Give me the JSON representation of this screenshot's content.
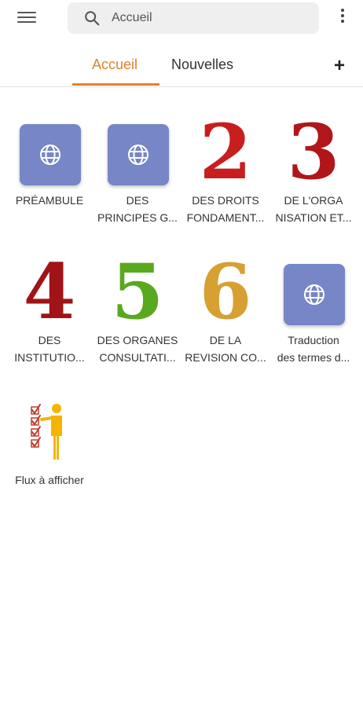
{
  "search": {
    "text": "Accueil",
    "icon": "search-icon"
  },
  "tabs": [
    {
      "label": "Accueil",
      "active": true
    },
    {
      "label": "Nouvelles",
      "active": false
    }
  ],
  "accent_color": "#e1822a",
  "tiles": [
    {
      "icon": "globe-icon",
      "label_lines": [
        "PRÉAMBULE"
      ]
    },
    {
      "icon": "globe-icon",
      "label_lines": [
        "DES",
        "PRINCIPES G..."
      ]
    },
    {
      "numeral": "2",
      "color": "#c81e1e",
      "label_lines": [
        "DES DROITS",
        "FONDAMENT..."
      ]
    },
    {
      "numeral": "3",
      "color": "#b0161a",
      "label_lines": [
        "DE L'ORGA",
        "NISATION ET..."
      ]
    },
    {
      "numeral": "4",
      "color": "#a01418",
      "label_lines": [
        "DES",
        "INSTITUTIO..."
      ]
    },
    {
      "numeral": "5",
      "color": "#5aa81e",
      "label_lines": [
        "DES ORGANES",
        "CONSULTATI..."
      ]
    },
    {
      "numeral": "6",
      "color": "#d6a032",
      "label_lines": [
        "DE LA",
        "REVISION CO..."
      ]
    },
    {
      "icon": "globe-icon",
      "label_lines": [
        "Traduction",
        "des termes d..."
      ]
    },
    {
      "icon": "checklist-person-icon",
      "label_lines": [
        "Flux à afficher"
      ]
    }
  ]
}
